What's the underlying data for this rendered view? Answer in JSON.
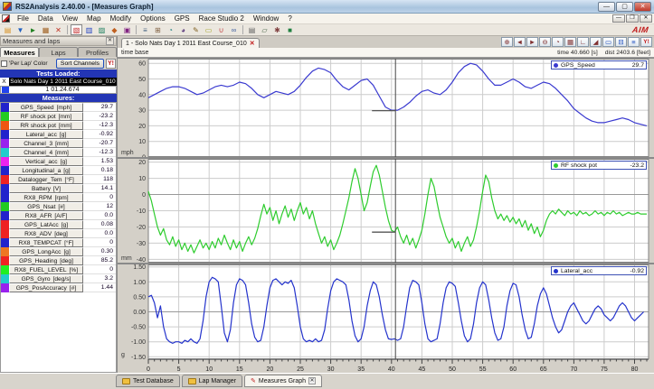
{
  "window": {
    "title": "RS2Analysis 2.40.00 - [Measures Graph]",
    "minimize": "—",
    "maximize": "▢",
    "close": "✕",
    "menu": [
      "File",
      "Data",
      "View",
      "Map",
      "Modify",
      "Options",
      "GPS",
      "Race Studio 2",
      "Window",
      "?"
    ],
    "aim_logo": "AIM"
  },
  "toolbar_icons": [
    {
      "name": "open-test-icon",
      "glyph": "▤",
      "color": "#d89020"
    },
    {
      "name": "download-data-icon",
      "glyph": "▼",
      "color": "#2060c0"
    },
    {
      "name": "online-icon",
      "glyph": "►",
      "color": "#208020"
    },
    {
      "name": "database-icon",
      "glyph": "▦",
      "color": "#a06020"
    },
    {
      "name": "delete-test-icon",
      "glyph": "✕",
      "color": "#c03020"
    },
    {
      "name": "sep",
      "glyph": "",
      "color": ""
    },
    {
      "name": "measures-graph-icon",
      "glyph": "▧",
      "color": "#c02020",
      "pressed": true
    },
    {
      "name": "histogram-icon",
      "glyph": "▥",
      "color": "#2040c0"
    },
    {
      "name": "xy-plot-icon",
      "glyph": "▨",
      "color": "#208060"
    },
    {
      "name": "track-map-icon",
      "glyph": "◆",
      "color": "#c06020"
    },
    {
      "name": "report-icon",
      "glyph": "▣",
      "color": "#802080"
    },
    {
      "name": "sep",
      "glyph": "",
      "color": ""
    },
    {
      "name": "split-lap-icon",
      "glyph": "≡",
      "color": "#406080"
    },
    {
      "name": "compare-icon",
      "glyph": "⊞",
      "color": "#806040"
    },
    {
      "name": "zoom-window-icon",
      "glyph": "◔",
      "color": "#208080"
    },
    {
      "name": "clock-icon",
      "glyph": "◕",
      "color": "#604080"
    },
    {
      "name": "pencil-icon",
      "glyph": "✎",
      "color": "#806020"
    },
    {
      "name": "eraser-icon",
      "glyph": "▭",
      "color": "#a0a020"
    },
    {
      "name": "magnet-icon",
      "glyph": "∪",
      "color": "#c04040"
    },
    {
      "name": "link-icon",
      "glyph": "∞",
      "color": "#4060a0"
    },
    {
      "name": "sep",
      "glyph": "",
      "color": ""
    },
    {
      "name": "printer-icon",
      "glyph": "▤",
      "color": "#606060"
    },
    {
      "name": "copy-icon",
      "glyph": "▱",
      "color": "#406040"
    },
    {
      "name": "settings-icon",
      "glyph": "✱",
      "color": "#804040"
    },
    {
      "name": "exit-icon",
      "glyph": "■",
      "color": "#208040"
    }
  ],
  "sidebar": {
    "header": "Measures and laps",
    "close": "✕",
    "tabs": [
      "Measures",
      "Laps",
      "Profiles"
    ],
    "active_tab": 0,
    "per_lap_color_label": "'Per Lap' Color",
    "sort_channels_label": "Sort Channels",
    "sort_icon_label": "Y!",
    "tests_loaded_header": "Tests Loaded:",
    "test_row": {
      "x": "X",
      "name": "Solo Nats Day 1 2011 East Course_010"
    },
    "lap_row": "1 01.24.674",
    "measures_header": "Measures:",
    "measures": [
      {
        "color": "#2222cc",
        "name": "GPS_Speed",
        "unit": "[mph]",
        "value": "29.7"
      },
      {
        "color": "#22cc22",
        "name": "RF shock pot",
        "unit": "[mm]",
        "value": "-23.2"
      },
      {
        "color": "#ee5511",
        "name": "RR shock pot",
        "unit": "[mm]",
        "value": "-12.3"
      },
      {
        "color": "#2222cc",
        "name": "Lateral_acc",
        "unit": "[g]",
        "value": "-0.92"
      },
      {
        "color": "#9922ee",
        "name": "Channel_3",
        "unit": "[mm]",
        "value": "-20.7"
      },
      {
        "color": "#22cccc",
        "name": "Channel_4",
        "unit": "[mm]",
        "value": "-12.3"
      },
      {
        "color": "#ee22ee",
        "name": "Vertical_acc",
        "unit": "[g]",
        "value": "1.53"
      },
      {
        "color": "#2222cc",
        "name": "Longitudinal_a",
        "unit": "[g]",
        "value": "0.18"
      },
      {
        "color": "#ee2222",
        "name": "Datalogger_Tem",
        "unit": "[°F]",
        "value": "118"
      },
      {
        "color": "#2222cc",
        "name": "Battery",
        "unit": "[V]",
        "value": "14.1"
      },
      {
        "color": "#2222cc",
        "name": "RX8_RPM",
        "unit": "[rpm]",
        "value": "0"
      },
      {
        "color": "#22cc22",
        "name": "GPS_Nsat",
        "unit": "[#]",
        "value": "12"
      },
      {
        "color": "#2222cc",
        "name": "RX8_AFR",
        "unit": "[A/F]",
        "value": "0.0"
      },
      {
        "color": "#ee2222",
        "name": "GPS_LatAcc",
        "unit": "[g]",
        "value": "0.08"
      },
      {
        "color": "#ee2222",
        "name": "RX8_ADV",
        "unit": "[deg]",
        "value": "0.0"
      },
      {
        "color": "#2222cc",
        "name": "RX8_TEMPCAT",
        "unit": "[°F]",
        "value": "0"
      },
      {
        "color": "#ee7722",
        "name": "GPS_LongAcc",
        "unit": "[g]",
        "value": "0.30"
      },
      {
        "color": "#ee2222",
        "name": "GPS_Heading",
        "unit": "[deg]",
        "value": "85.2"
      },
      {
        "color": "#22ee22",
        "name": "RX8_FUEL_LEVEL",
        "unit": "[%]",
        "value": "0"
      },
      {
        "color": "#22cccc",
        "name": "GPS_Gyro",
        "unit": "[deg/s]",
        "value": "3.2"
      },
      {
        "color": "#9922ee",
        "name": "GPS_PosAccuracy",
        "unit": "[#]",
        "value": "1.44"
      }
    ]
  },
  "graph": {
    "tab_title": "1 - Solo Nats Day 1 2011 East Course_010",
    "tab_close": "✕",
    "base_label": "time base",
    "time_label": "time 40.660 [s]",
    "dist_label": "dist 2403.6 [feet]",
    "cursor_time": 40.66,
    "x_max": 82.3,
    "x_ticks": [
      0,
      5,
      10,
      15,
      20,
      25,
      30,
      35,
      40,
      45,
      50,
      55,
      60,
      65,
      70,
      75,
      80
    ],
    "icons": [
      {
        "name": "zoom-in-icon",
        "glyph": "⊕"
      },
      {
        "name": "zoom-prev-icon",
        "glyph": "◄"
      },
      {
        "name": "zoom-next-icon",
        "glyph": "►"
      },
      {
        "name": "zoom-out-icon",
        "glyph": "⊖"
      },
      {
        "name": "time-base-icon",
        "glyph": "◔"
      },
      {
        "name": "distance-base-icon",
        "glyph": "▦"
      },
      {
        "name": "axes-icon",
        "glyph": "∟"
      },
      {
        "name": "marker-icon",
        "glyph": "◢"
      },
      {
        "name": "layout-single-icon",
        "glyph": "▭"
      },
      {
        "name": "layout-split-icon",
        "glyph": "⊟"
      },
      {
        "name": "layout-multi-icon",
        "glyph": "≡"
      },
      {
        "name": "sort-channels-icon",
        "glyph": "Y!"
      }
    ]
  },
  "chart_data": [
    {
      "type": "line",
      "name": "GPS_Speed",
      "unit": "mph",
      "color": "#3a3ad0",
      "ymin": 0,
      "ymax": 63,
      "ytick_values": [
        60,
        50,
        40,
        30,
        20,
        10,
        0
      ],
      "ytick_labels": [
        "60",
        "50",
        "40",
        "30",
        "20",
        "10",
        "0"
      ],
      "legend": {
        "label": "GPS_Speed",
        "value": "29.7"
      },
      "cursor_dash": true,
      "x_start": 0,
      "x_step": 1,
      "values": [
        38,
        40,
        42,
        44,
        45,
        45,
        44,
        42,
        40,
        41,
        43,
        45,
        46,
        45,
        46,
        48,
        47,
        44,
        40,
        38,
        40,
        42,
        41,
        40,
        42,
        46,
        51,
        55,
        57,
        56,
        54,
        49,
        45,
        43,
        46,
        49,
        50,
        46,
        39,
        32,
        30,
        30,
        32,
        35,
        39,
        42,
        43,
        41,
        40,
        43,
        48,
        54,
        58,
        60,
        59,
        55,
        50,
        46,
        46,
        48,
        50,
        48,
        45,
        44,
        46,
        48,
        47,
        44,
        40,
        36,
        31,
        28,
        25,
        23,
        22,
        22,
        23,
        24,
        25,
        24,
        22,
        21,
        20
      ]
    },
    {
      "type": "line",
      "name": "RF shock pot",
      "unit": "mm",
      "color": "#2ecc2e",
      "ymin": -42,
      "ymax": 22,
      "ytick_values": [
        20,
        10,
        0,
        -10,
        -20,
        -30,
        -40
      ],
      "ytick_labels": [
        "20",
        "10",
        "0",
        "-10",
        "-20",
        "-30",
        "-40"
      ],
      "legend": {
        "label": "RF shock pot",
        "value": "-23.2"
      },
      "cursor_dash": true,
      "x_start": 0,
      "x_step": 0.5,
      "values": [
        2,
        -4,
        -12,
        -20,
        -25,
        -21,
        -28,
        -31,
        -26,
        -32,
        -28,
        -34,
        -30,
        -35,
        -31,
        -36,
        -32,
        -28,
        -33,
        -30,
        -34,
        -29,
        -33,
        -27,
        -31,
        -25,
        -30,
        -34,
        -28,
        -33,
        -29,
        -35,
        -30,
        -26,
        -31,
        -27,
        -21,
        -13,
        -6,
        -12,
        -8,
        -16,
        -10,
        -18,
        -12,
        -7,
        -14,
        -9,
        -16,
        -10,
        -5,
        -12,
        -8,
        -15,
        -10,
        -18,
        -24,
        -30,
        -26,
        -32,
        -28,
        -34,
        -30,
        -25,
        -18,
        -10,
        -2,
        8,
        16,
        10,
        0,
        -10,
        -5,
        5,
        14,
        18,
        12,
        2,
        -8,
        -16,
        -22,
        -23,
        -20,
        -26,
        -30,
        -25,
        -31,
        -27,
        -33,
        -28,
        -22,
        -12,
        0,
        10,
        5,
        -5,
        -14,
        -20,
        -26,
        -30,
        -27,
        -33,
        -29,
        -35,
        -30,
        -26,
        -32,
        -28,
        -20,
        -10,
        2,
        12,
        8,
        -2,
        -10,
        -15,
        -12,
        -16,
        -13,
        -17,
        -14,
        -18,
        -15,
        -20,
        -16,
        -22,
        -18,
        -24,
        -20,
        -26,
        -22,
        -16,
        -12,
        -10,
        -12,
        -9,
        -11,
        -13,
        -10,
        -12,
        -11,
        -13,
        -10,
        -12,
        -11,
        -13,
        -12,
        -10,
        -12,
        -11,
        -13,
        -11,
        -12,
        -10,
        -12,
        -11,
        -13,
        -12,
        -11,
        -12,
        -12,
        -11,
        -12,
        -12,
        -12
      ]
    },
    {
      "type": "line",
      "name": "Lateral_acc",
      "unit": "g",
      "color": "#2433cc",
      "ymin": -1.58,
      "ymax": 1.58,
      "ytick_values": [
        1.5,
        1.0,
        0.5,
        0.0,
        -0.5,
        -1.0,
        -1.5
      ],
      "ytick_labels": [
        "1.50",
        "1.00",
        "0.50",
        "0.00",
        "-0.50",
        "-1.00",
        "-1.50"
      ],
      "legend": {
        "label": "Lateral_acc",
        "value": "-0.92"
      },
      "cursor_dash": false,
      "x_start": 0,
      "x_step": 0.5,
      "values": [
        0.5,
        0.55,
        0.3,
        -0.2,
        0.2,
        -0.5,
        -0.9,
        -1.0,
        -1.05,
        -1.0,
        -1.0,
        -1.05,
        -0.95,
        -1.0,
        -0.9,
        -1.0,
        -1.05,
        -0.9,
        -0.3,
        0.5,
        1.0,
        1.15,
        1.1,
        1.0,
        0.2,
        -0.7,
        -1.0,
        -0.6,
        0.3,
        0.9,
        1.1,
        1.05,
        0.9,
        0.3,
        -0.4,
        -0.85,
        -1.0,
        -0.95,
        -0.5,
        0.2,
        0.8,
        1.05,
        1.1,
        1.0,
        0.9,
        1.0,
        0.95,
        1.05,
        0.8,
        0.2,
        -0.5,
        -0.9,
        -1.0,
        -0.95,
        -1.0,
        -0.9,
        -1.0,
        -0.95,
        -0.6,
        0.1,
        0.7,
        1.0,
        1.1,
        1.05,
        1.0,
        0.9,
        0.4,
        -0.3,
        -0.8,
        -1.0,
        -0.9,
        -0.5,
        0.2,
        0.7,
        1.0,
        0.9,
        0.5,
        -0.1,
        -0.6,
        -0.9,
        -0.92,
        -0.9,
        -0.95,
        -0.9,
        -0.5,
        0.2,
        0.8,
        1.05,
        1.0,
        0.9,
        0.3,
        -0.4,
        -0.9,
        -1.0,
        -0.95,
        -0.9,
        -0.4,
        0.3,
        0.8,
        1.0,
        0.95,
        0.85,
        0.3,
        -0.3,
        -0.8,
        -1.0,
        -0.9,
        -0.4,
        0.3,
        0.8,
        1.0,
        0.9,
        0.4,
        -0.2,
        -0.7,
        -0.95,
        -0.9,
        -0.5,
        0.2,
        0.7,
        0.95,
        0.9,
        0.5,
        -0.1,
        -0.6,
        -0.9,
        -0.85,
        -0.4,
        0.2,
        0.6,
        0.8,
        0.6,
        0.2,
        -0.2,
        -0.5,
        -0.7,
        -0.6,
        -0.3,
        0.0,
        0.2,
        0.3,
        0.1,
        -0.1,
        -0.3,
        -0.4,
        -0.3,
        -0.1,
        0.1,
        0.2,
        0.1,
        -0.1,
        -0.2,
        -0.3,
        -0.2,
        0.0,
        0.2,
        0.3,
        0.2,
        0.0,
        -0.2,
        -0.3,
        -0.2,
        -0.1,
        0.0
      ]
    }
  ],
  "bottom_tabs": [
    {
      "label": "Test Database",
      "icon": "folder",
      "active": false
    },
    {
      "label": "Lap Manager",
      "icon": "folder",
      "active": false
    },
    {
      "label": "Measures Graph",
      "icon": "pen",
      "active": true,
      "closable": true
    }
  ]
}
